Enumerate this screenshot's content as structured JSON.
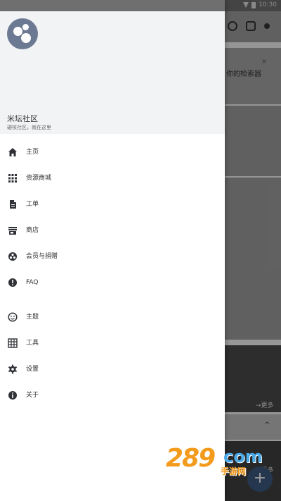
{
  "status_bar": {
    "time": "10:30"
  },
  "background": {
    "snippet_text": "你的检索器",
    "more_label_1": "→更多",
    "more_label_2": "→更多"
  },
  "drawer": {
    "app_name": "米坛社区",
    "app_subtitle": "硬核社区，就在这里",
    "items": [
      {
        "label": "主页",
        "icon": "home-icon"
      },
      {
        "label": "资源商城",
        "icon": "grid-dots-icon"
      },
      {
        "label": "工单",
        "icon": "document-icon"
      },
      {
        "label": "商店",
        "icon": "store-icon"
      },
      {
        "label": "会员与捐赠",
        "icon": "membership-icon"
      },
      {
        "label": "FAQ",
        "icon": "help-icon"
      },
      {
        "label": "主题",
        "icon": "theme-icon"
      },
      {
        "label": "工具",
        "icon": "tools-grid-icon"
      },
      {
        "label": "设置",
        "icon": "settings-gear-icon"
      },
      {
        "label": "关于",
        "icon": "info-icon"
      }
    ]
  },
  "watermark": {
    "number": "289",
    "domain": "com",
    "text": "手游网"
  },
  "colors": {
    "icon": "#2f3136",
    "accent": "#3a5a80",
    "header_bg": "#f2f3f5"
  }
}
